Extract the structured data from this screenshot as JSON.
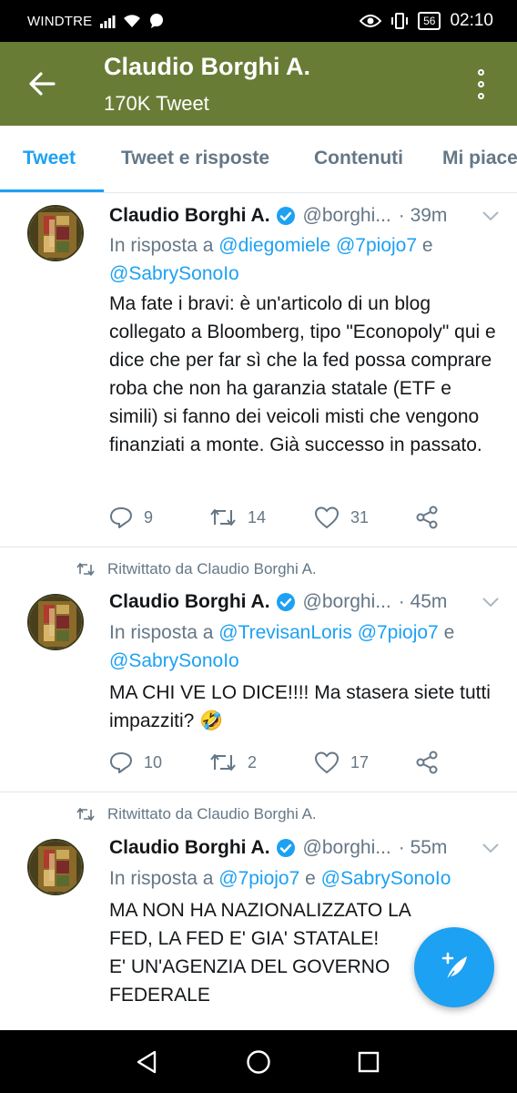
{
  "status_bar": {
    "carrier": "WINDTRE",
    "battery": "56",
    "time": "02:10"
  },
  "header": {
    "title": "Claudio Borghi A.",
    "subtitle": "170K Tweet"
  },
  "tabs": [
    {
      "label": "Tweet",
      "active": true
    },
    {
      "label": "Tweet e risposte",
      "active": false
    },
    {
      "label": "Contenuti",
      "active": false
    },
    {
      "label": "Mi piace",
      "active": false
    }
  ],
  "tweets": [
    {
      "retweeted_by": "",
      "name": "Claudio Borghi A.",
      "handle": "@borghi...",
      "time": "· 39m",
      "reply_prefix": "In risposta a",
      "reply_mentions": [
        "@diegomiele",
        "@7piojo7",
        "@SabrySonoIo"
      ],
      "reply_joiner": "e",
      "text": "Ma fate i bravi: è un'articolo di un blog collegato a Bloomberg, tipo \"Econopoly\" qui e dice che per far sì che la fed possa comprare roba che non ha garanzia statale (ETF e simili) si fanno dei veicoli misti che vengono finanziati a monte. Già successo in passato.",
      "replies": "9",
      "retweets": "14",
      "likes": "31"
    },
    {
      "retweeted_by": "Ritwittato da Claudio Borghi A.",
      "name": "Claudio Borghi A.",
      "handle": "@borghi...",
      "time": "· 45m",
      "reply_prefix": "In risposta a",
      "reply_mentions": [
        "@TrevisanLoris",
        "@7piojo7",
        "@SabrySonoIo"
      ],
      "reply_joiner": "e",
      "text": "MA CHI VE LO DICE!!!! Ma stasera siete tutti impazziti? 🤣",
      "replies": "10",
      "retweets": "2",
      "likes": "17"
    },
    {
      "retweeted_by": "Ritwittato da Claudio Borghi A.",
      "name": "Claudio Borghi A.",
      "handle": "@borghi...",
      "time": "· 55m",
      "reply_prefix": "In risposta a",
      "reply_mentions": [
        "@7piojo7",
        "@SabrySonoIo"
      ],
      "reply_joiner": "e",
      "text": "MA NON HA NAZIONALIZZATO LA FED, LA FED E' GIA' STATALE!\nE' UN'AGENZIA DEL GOVERNO FEDERALE",
      "replies": "",
      "retweets": "",
      "likes": ""
    }
  ],
  "colors": {
    "header_bg": "#687c35",
    "accent": "#1da1f2",
    "muted": "#657786"
  },
  "icons": [
    "back-arrow-icon",
    "overflow-menu-icon",
    "verified-badge-icon",
    "chevron-down-icon",
    "reply-icon",
    "retweet-icon",
    "like-icon",
    "share-icon",
    "compose-icon"
  ]
}
